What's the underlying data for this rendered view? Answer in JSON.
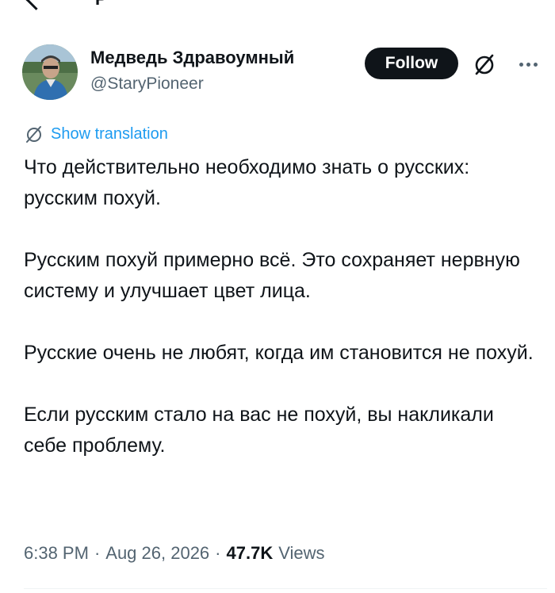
{
  "top_partial": {
    "text": "P "
  },
  "author": {
    "name": "Медведь Здравоумный",
    "handle": "@StaryPioneer"
  },
  "actions": {
    "follow_label": "Follow"
  },
  "translate": {
    "label": "Show translation"
  },
  "tweet": {
    "paragraphs": [
      "Что действительно необходимо знать о русских: русским похуй.",
      "Русским похуй примерно всё. Это сохраняет нервную систему и улучшает цвет лица.",
      "Русские очень не любят, когда им становится не похуй.",
      "Если русским стало на вас не похуй, вы накликали себе проблему."
    ]
  },
  "meta": {
    "time": "6:38 PM",
    "separator": "·",
    "date": "Aug 26, 2026",
    "views_count": "47.7K",
    "views_label": "Views"
  },
  "colors": {
    "text": "#0f1419",
    "secondary": "#536471",
    "link": "#1d9bf0",
    "follow_bg": "#0f1419"
  },
  "icons": {
    "grok": "grok-icon",
    "more": "more-icon",
    "translate": "translate-icon"
  }
}
